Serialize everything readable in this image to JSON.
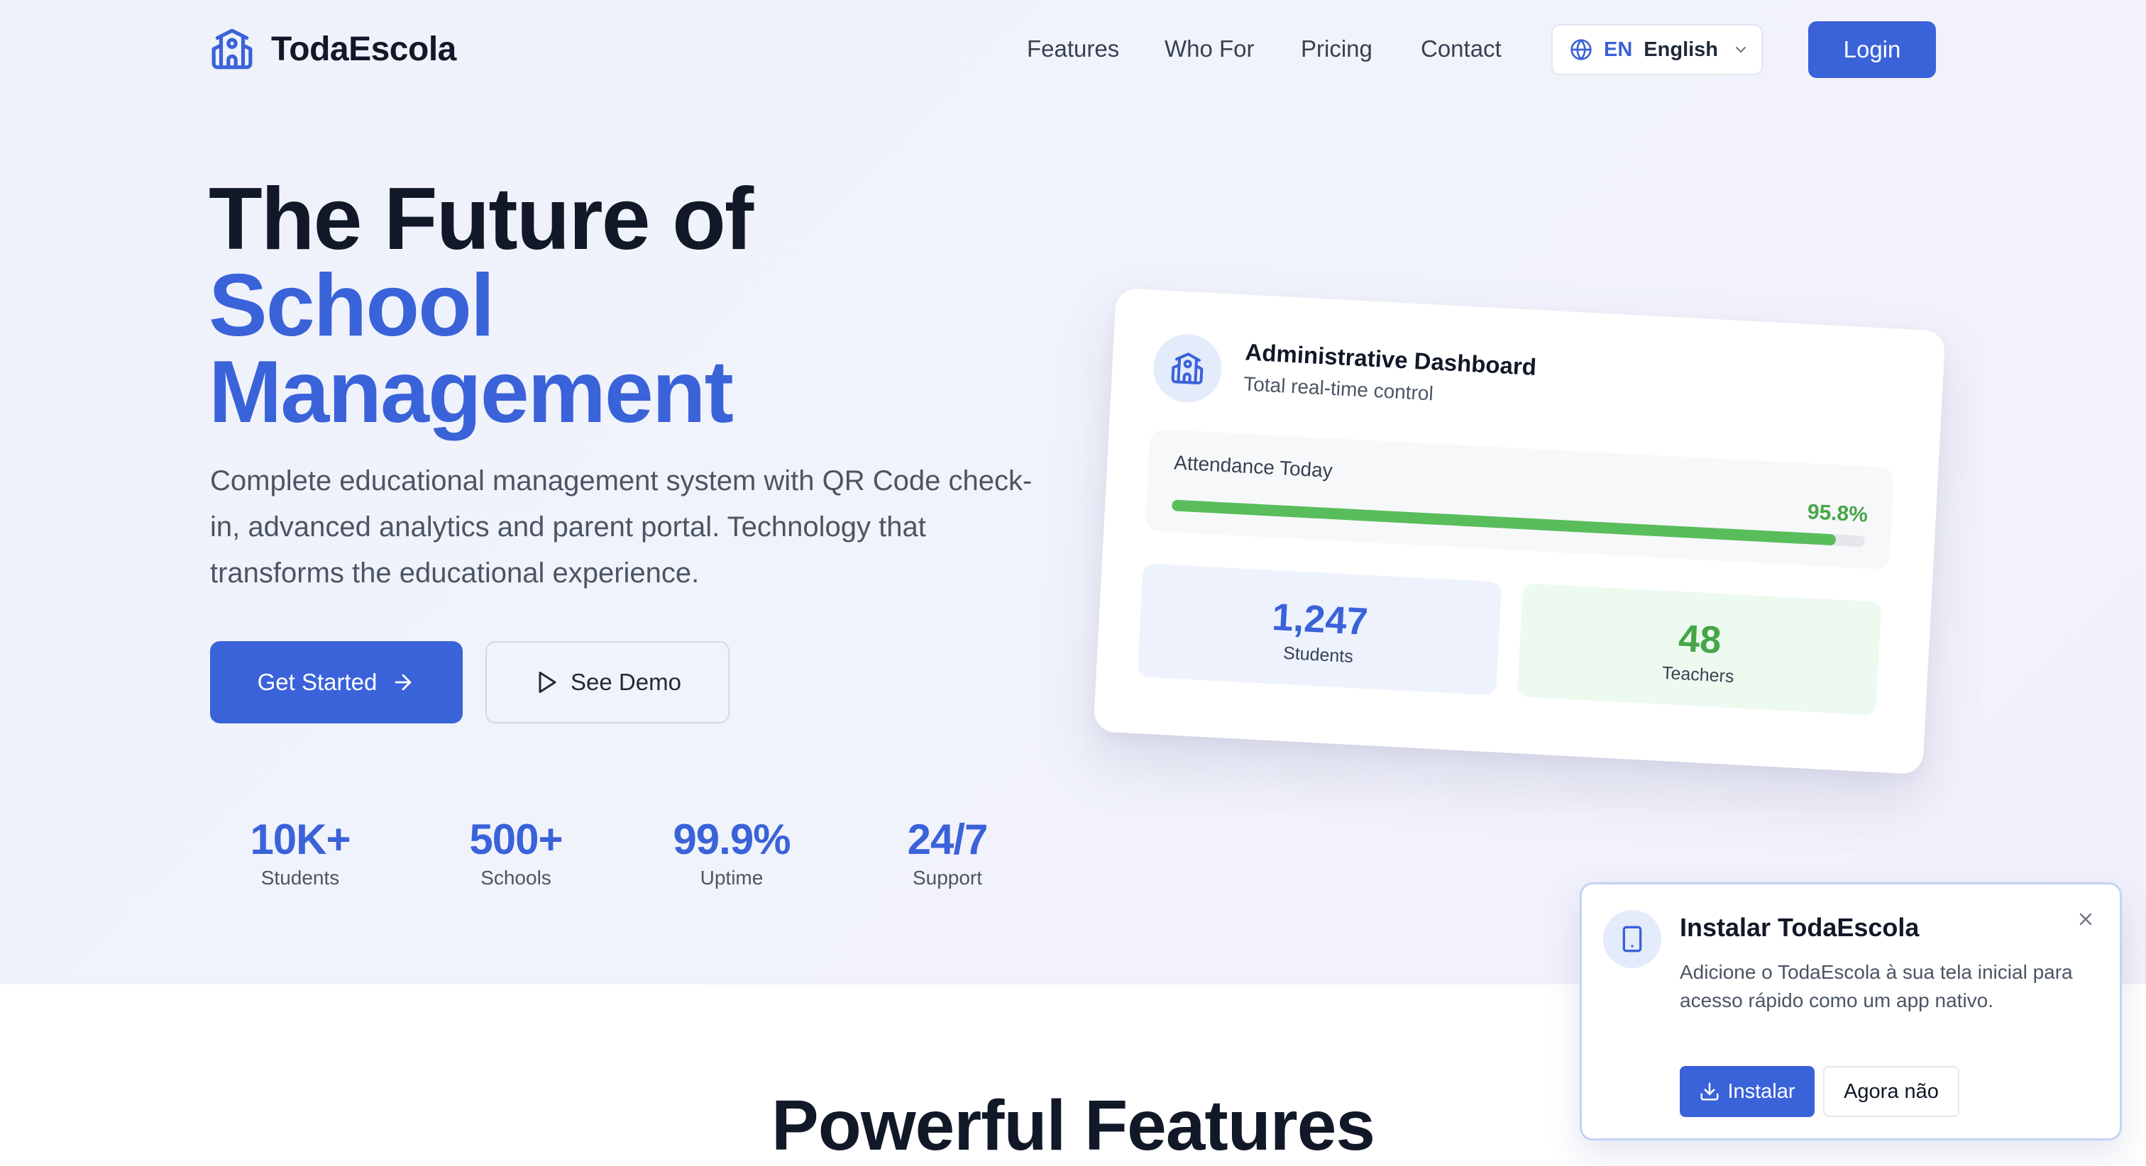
{
  "header": {
    "brand": "TodaEscola",
    "nav": [
      "Features",
      "Who For",
      "Pricing",
      "Contact"
    ],
    "language": {
      "code": "EN",
      "name": "English"
    },
    "login_label": "Login"
  },
  "hero": {
    "title_line1": "The Future of",
    "title_line2": "School",
    "title_line3": "Management",
    "description": "Complete educational management system with QR Code check-in, advanced analytics and parent portal. Technology that transforms the educational experience.",
    "cta_primary": "Get Started",
    "cta_secondary": "See Demo",
    "stats": [
      {
        "value": "10K+",
        "label": "Students"
      },
      {
        "value": "500+",
        "label": "Schools"
      },
      {
        "value": "99.9%",
        "label": "Uptime"
      },
      {
        "value": "24/7",
        "label": "Support"
      }
    ]
  },
  "dashboard": {
    "title": "Administrative Dashboard",
    "subtitle": "Total real-time control",
    "attendance_label": "Attendance Today",
    "attendance_value": "95.8%",
    "attendance_fraction": 0.958,
    "students_count": "1,247",
    "students_label": "Students",
    "teachers_count": "48",
    "teachers_label": "Teachers"
  },
  "features": {
    "title": "Powerful Features"
  },
  "install_prompt": {
    "title": "Instalar TodaEscola",
    "description": "Adicione o TodaEscola à sua tela inicial para acesso rápido como um app nativo.",
    "install_label": "Instalar",
    "dismiss_label": "Agora não"
  },
  "colors": {
    "primary": "#3a62d9",
    "success": "#46a649",
    "text": "#111827",
    "muted": "#4b5563"
  }
}
